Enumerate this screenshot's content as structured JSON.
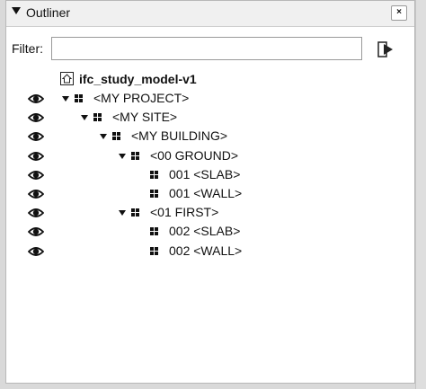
{
  "panel": {
    "title": "Outliner",
    "close_label": "×"
  },
  "filter": {
    "label": "Filter:",
    "value": "",
    "placeholder": ""
  },
  "tree": {
    "model": {
      "label": "ifc_study_model-v1",
      "icon": "model-house-icon"
    },
    "items": [
      {
        "label": "<MY PROJECT>",
        "level": 0,
        "expanded": true,
        "visible": true,
        "icon": "component-icon"
      },
      {
        "label": "<MY SITE>",
        "level": 1,
        "expanded": true,
        "visible": true,
        "icon": "component-icon"
      },
      {
        "label": "<MY BUILDING>",
        "level": 2,
        "expanded": true,
        "visible": true,
        "icon": "component-icon"
      },
      {
        "label": "<00 GROUND>",
        "level": 3,
        "expanded": true,
        "visible": true,
        "icon": "component-icon"
      },
      {
        "label": "001 <SLAB>",
        "level": 4,
        "expanded": false,
        "visible": true,
        "icon": "component-icon"
      },
      {
        "label": "001 <WALL>",
        "level": 4,
        "expanded": false,
        "visible": true,
        "icon": "component-icon"
      },
      {
        "label": "<01 FIRST>",
        "level": 3,
        "expanded": true,
        "visible": true,
        "icon": "component-icon"
      },
      {
        "label": "002 <SLAB>",
        "level": 4,
        "expanded": false,
        "visible": true,
        "icon": "component-icon"
      },
      {
        "label": "002 <WALL>",
        "level": 4,
        "expanded": false,
        "visible": true,
        "icon": "component-icon"
      }
    ]
  }
}
